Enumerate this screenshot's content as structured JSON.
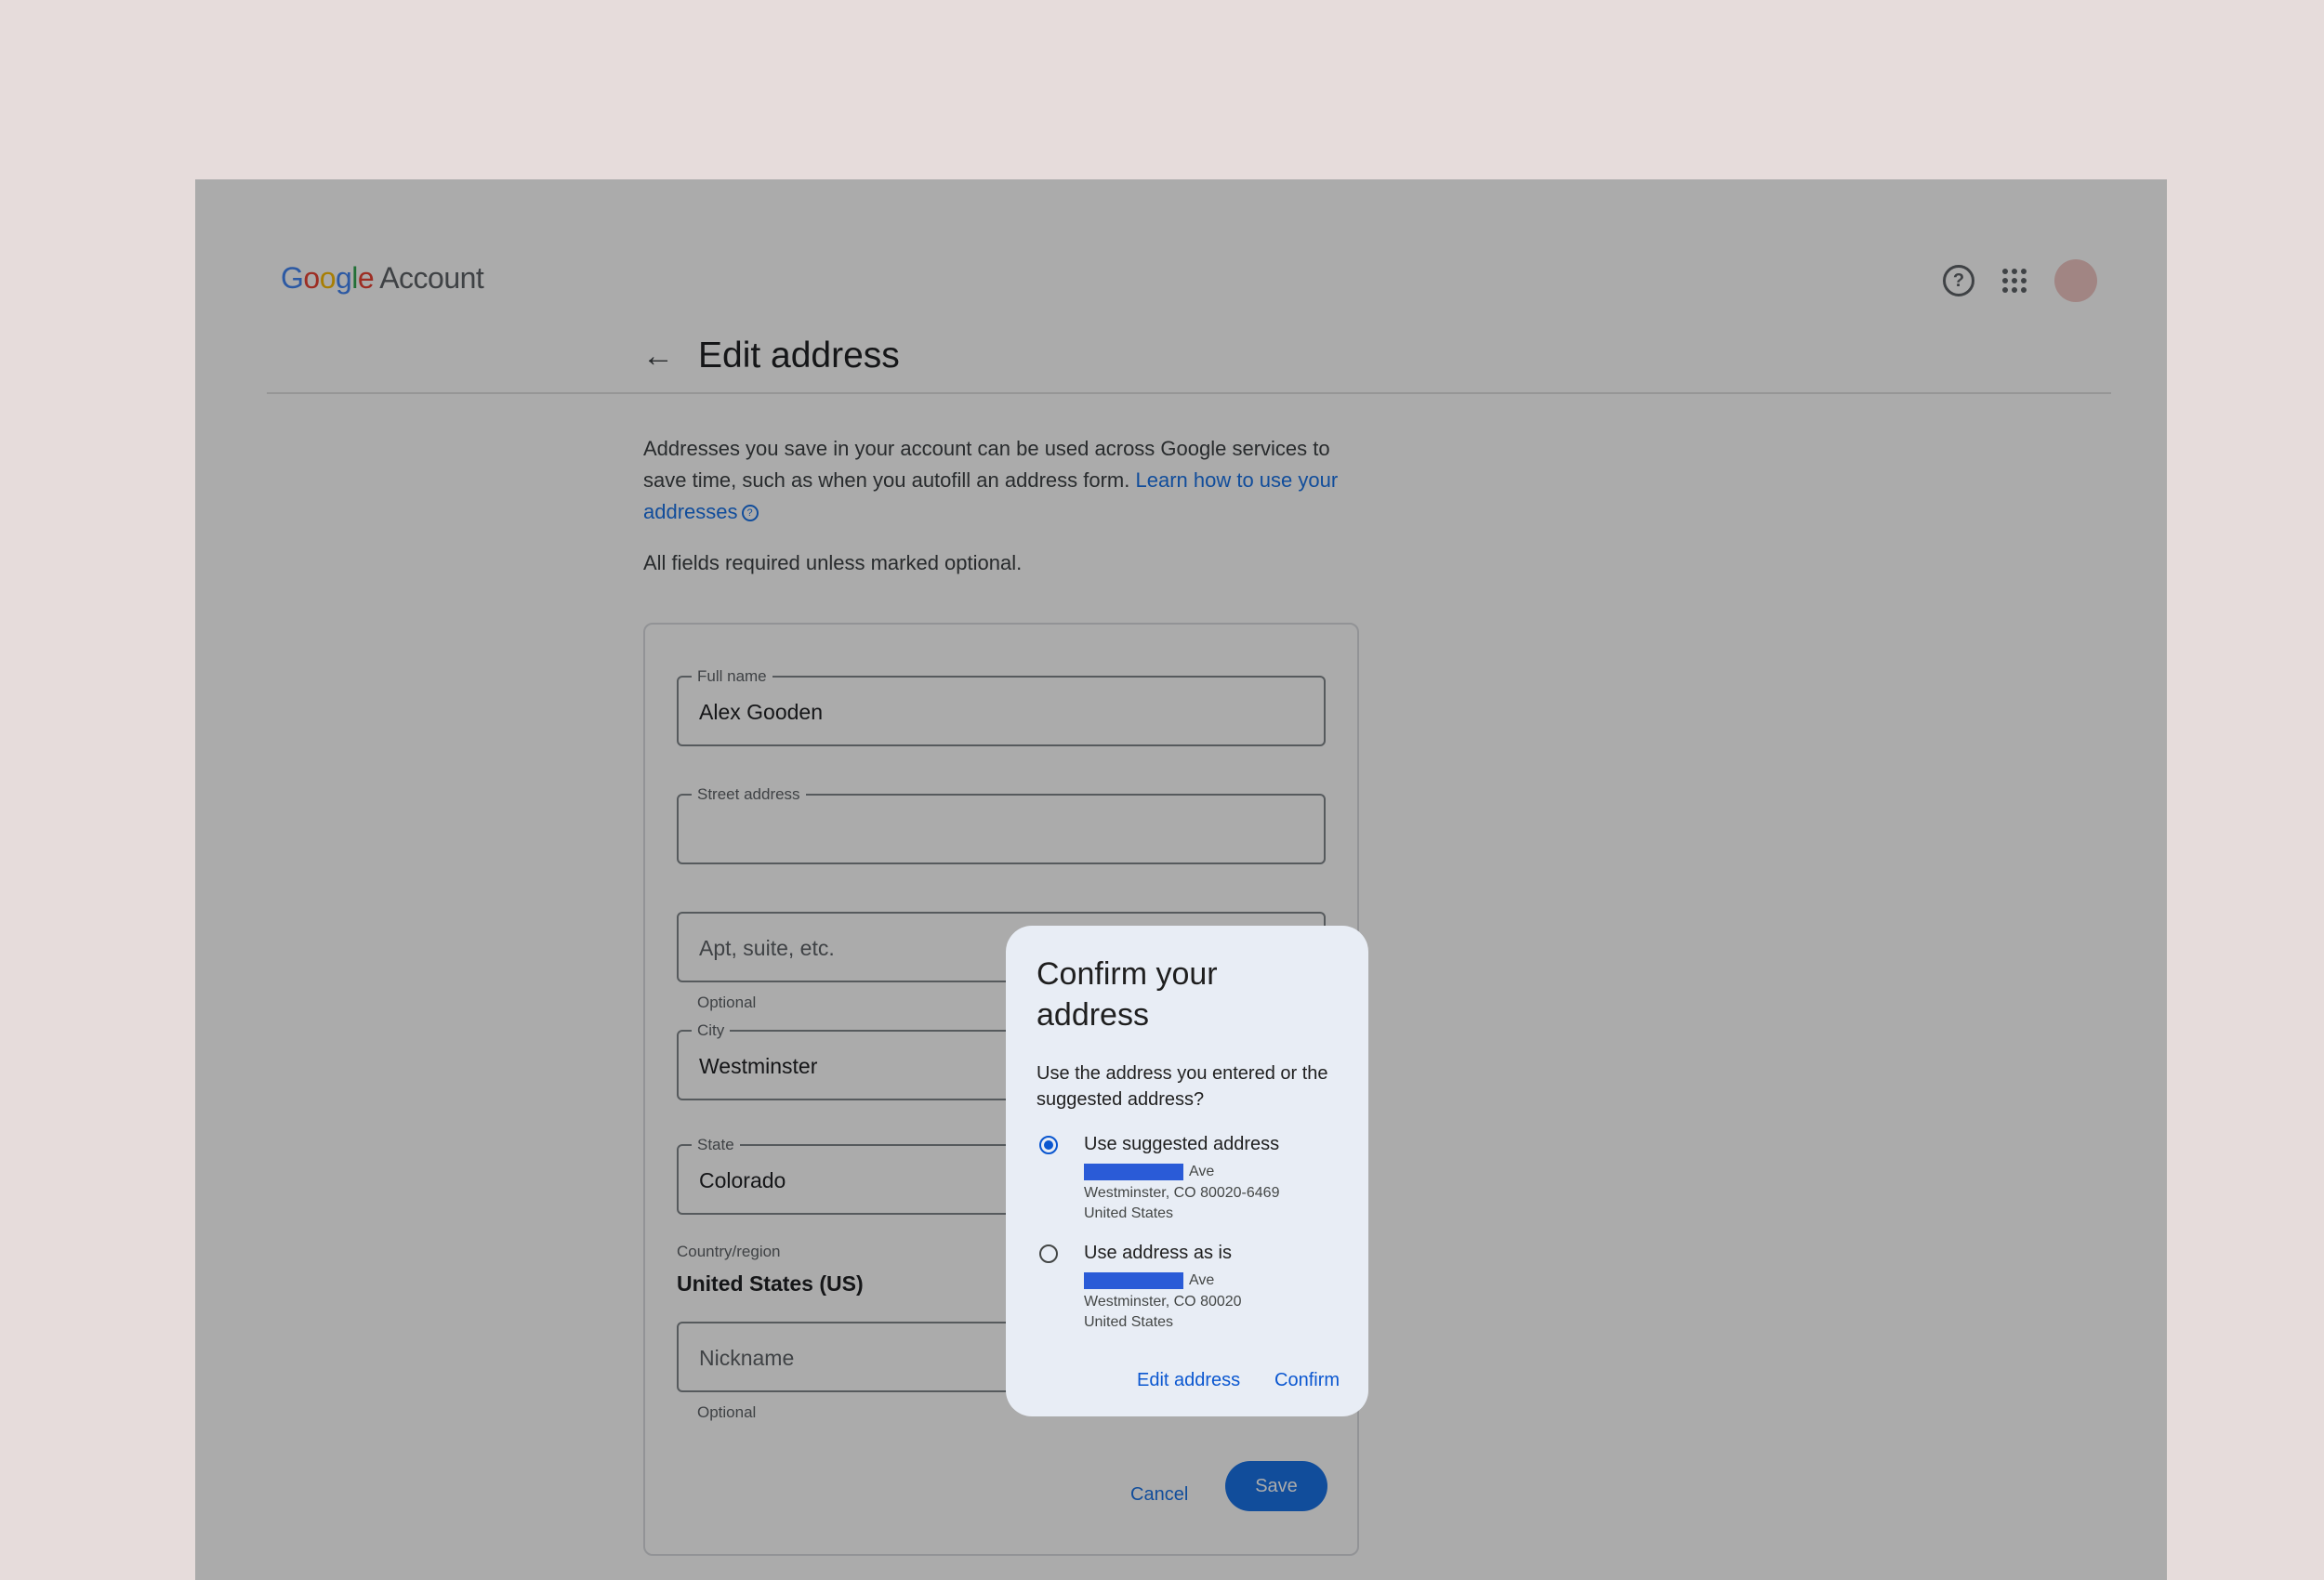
{
  "header": {
    "logo_letters": [
      "G",
      "o",
      "o",
      "g",
      "l",
      "e"
    ],
    "logo_suffix": "Account"
  },
  "page": {
    "title": "Edit address",
    "intro_text": "Addresses you save in your account can be used across Google services to save time, such as when you autofill an address form. ",
    "intro_link": "Learn how to use your addresses",
    "required_note": "All fields required unless marked optional."
  },
  "form": {
    "full_name": {
      "label": "Full name",
      "value": "Alex Gooden"
    },
    "street": {
      "label": "Street address",
      "value": ""
    },
    "apt": {
      "placeholder": "Apt, suite, etc.",
      "helper": "Optional"
    },
    "city": {
      "label": "City",
      "value": "Westminster"
    },
    "state": {
      "label": "State",
      "value": "Colorado"
    },
    "country": {
      "label": "Country/region",
      "value": "United States (US)"
    },
    "nickname": {
      "placeholder": "Nickname",
      "helper": "Optional"
    },
    "cancel_label": "Cancel",
    "save_label": "Save"
  },
  "dialog": {
    "title": "Confirm your address",
    "description": "Use the address you entered or the suggested address?",
    "options": [
      {
        "label": "Use suggested address",
        "selected": true,
        "street_suffix": "Ave",
        "city_line": "Westminster, CO 80020-6469",
        "country_line": "United States"
      },
      {
        "label": "Use address as is",
        "selected": false,
        "street_suffix": "Ave",
        "city_line": "Westminster, CO 80020",
        "country_line": "United States"
      }
    ],
    "edit_label": "Edit address",
    "confirm_label": "Confirm"
  },
  "colors": {
    "accent": "#1a73e8",
    "dialog_bg": "#e8edf5",
    "redaction": "#2a5bd7"
  }
}
